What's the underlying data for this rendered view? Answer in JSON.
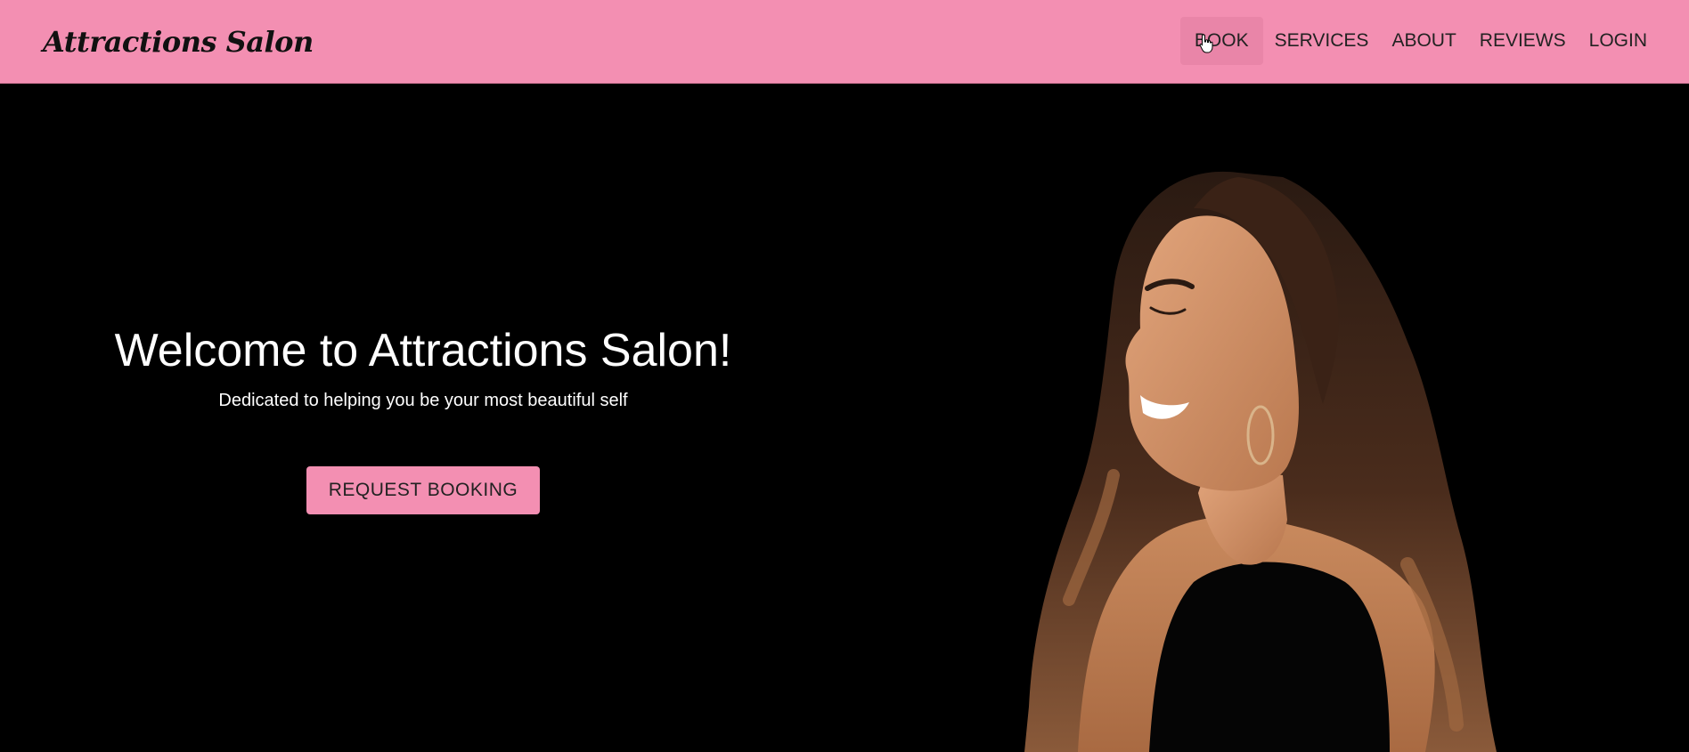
{
  "brand": {
    "name": "Attractions Salon"
  },
  "nav": {
    "items": [
      {
        "label": "BOOK"
      },
      {
        "label": "SERVICES"
      },
      {
        "label": "ABOUT"
      },
      {
        "label": "REVIEWS"
      },
      {
        "label": "LOGIN"
      }
    ]
  },
  "hero": {
    "title": "Welcome to Attractions Salon!",
    "subtitle": "Dedicated to helping you be your most beautiful self",
    "cta_label": "REQUEST BOOKING",
    "photo_icon": "smiling-woman-photo"
  },
  "colors": {
    "accent": "#f38fb2",
    "accent_hover": "#e985a8",
    "background": "#000000",
    "text_light": "#ffffff",
    "text_dark": "#222222"
  }
}
